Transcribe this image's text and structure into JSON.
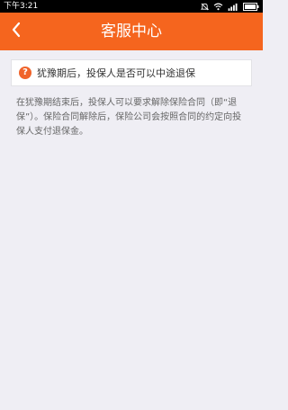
{
  "status_bar": {
    "time": "下午3:21",
    "icons": [
      "alarm-off-icon",
      "wifi-icon",
      "signal-icon",
      "battery-icon"
    ]
  },
  "header": {
    "title": "客服中心",
    "back_icon": "chevron-left-icon"
  },
  "faq": {
    "question_badge": "?",
    "question": "犹豫期后，投保人是否可以中途退保",
    "answer": "在犹豫期结束后，投保人可以要求解除保险合同（即“退保”）。保险合同解除后，保险公司会按照合同的约定向投保人支付退保金。"
  },
  "colors": {
    "accent": "#f5651e",
    "background": "#efeef4"
  }
}
